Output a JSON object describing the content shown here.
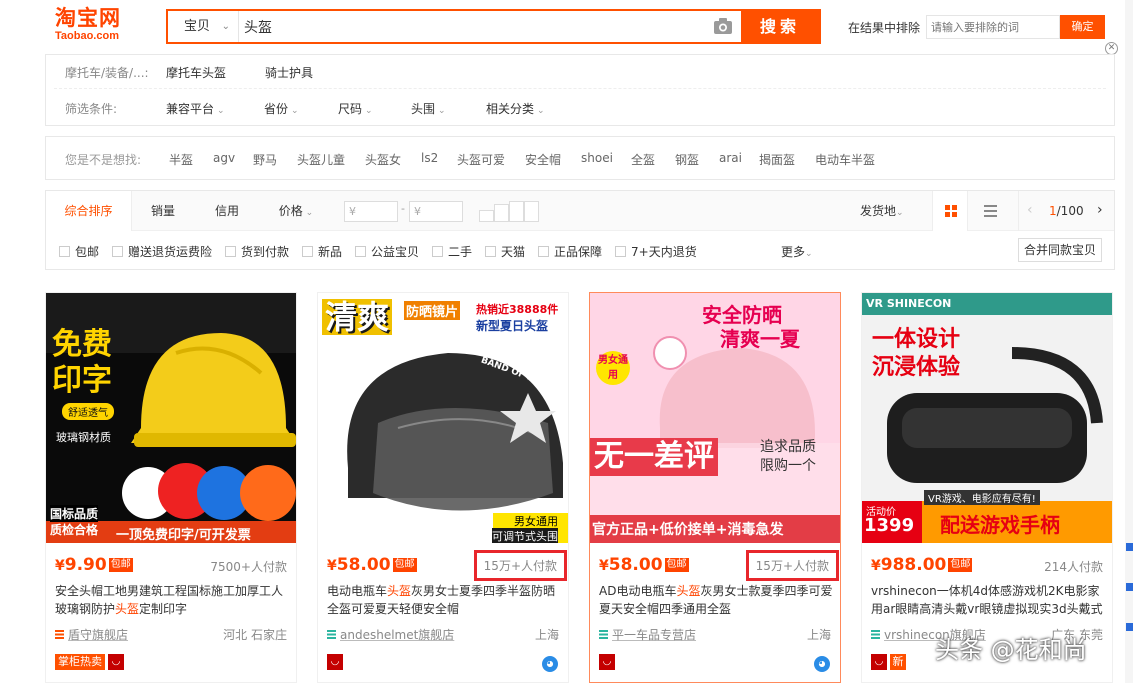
{
  "logo": {
    "cn": "淘宝网",
    "en": "Taobao.com"
  },
  "search": {
    "category": "宝贝",
    "query": "头盔",
    "button": "搜索"
  },
  "exclude": {
    "label": "在结果中排除",
    "placeholder": "请输入要排除的词",
    "confirm": "确定"
  },
  "filters": {
    "row1_key": "摩托车/装备/...:",
    "row1_values": [
      "摩托车头盔",
      "骑士护具"
    ],
    "row2_key": "筛选条件:",
    "row2_values": [
      "兼容平台",
      "省份",
      "尺码",
      "头围",
      "相关分类"
    ]
  },
  "suggest": {
    "label": "您是不是想找:",
    "items": [
      "半盔",
      "agv",
      "野马",
      "头盔儿童",
      "头盔女",
      "ls2",
      "头盔可爱",
      "安全帽",
      "shoei",
      "全盔",
      "钢盔",
      "arai",
      "揭面盔",
      "电动车半盔"
    ]
  },
  "sort": {
    "tabs": [
      "综合排序",
      "销量",
      "信用",
      "价格"
    ],
    "price_min_placeholder": "¥",
    "price_max_placeholder": "¥",
    "dash": "-",
    "ship_from": "发货地",
    "page_current": "1",
    "page_total": "/100"
  },
  "checks": {
    "items": [
      "包邮",
      "赠送退货运费险",
      "货到付款",
      "新品",
      "公益宝贝",
      "二手",
      "天猫",
      "正品保障",
      "7+天内退货"
    ],
    "more": "更多",
    "merge": "合并同款宝贝"
  },
  "products": [
    {
      "price": "9.90",
      "currency": "¥",
      "postage": "包邮",
      "paid": "7500+人付款",
      "title_pre": "安全头帽工地男建筑工程国标施工加厚工人玻璃钢防护",
      "title_kw": "头盔",
      "title_post": "定制印字",
      "shop": "盾守旗舰店",
      "loc": "河北 石家庄",
      "badge": "掌柜热卖",
      "img": {
        "line1": "免费",
        "line2": "印字",
        "sub": "舒适透气",
        "material": "玻璃钢材质",
        "b1": "国标品质",
        "b2": "质检合格",
        "banner": "一顶免费印字/可开发票"
      }
    },
    {
      "price": "58.00",
      "currency": "¥",
      "postage": "包邮",
      "paid": "15万+人付款",
      "title_pre": "电动电瓶车",
      "title_kw": "头盔",
      "title_post": "灰男女士夏季四季半盔防晒全盔可爱夏天轻便安全帽",
      "shop": "andeshelmet旗舰店",
      "loc": "上海",
      "img": {
        "big": "清爽",
        "tag1": "防晒镜片",
        "tag2": "热销近38888件",
        "tag3": "新型夏日头盔",
        "brand": "BAND OF BROTHERS",
        "c1": "男女通用",
        "c2": "可调节式头围"
      }
    },
    {
      "price": "58.00",
      "currency": "¥",
      "postage": "包邮",
      "paid": "15万+人付款",
      "title_pre": "AD电动电瓶车",
      "title_kw": "头盔",
      "title_post": "灰男女士款夏季四季可爱夏天安全帽四季通用全盔",
      "shop": "平一车品专营店",
      "loc": "上海",
      "img": {
        "top1": "安全防晒",
        "top2": "清爽一夏",
        "round": "男女通用",
        "mid": "无一差评",
        "r1": "追求品质",
        "r2": "限购一个",
        "bottom": "官方正品+低价接单+消毒急发"
      }
    },
    {
      "price": "988.00",
      "currency": "¥",
      "postage": "包邮",
      "paid": "214人付款",
      "title_pre": "vrshinecon一体机4d体感游戏机2K电影家用ar眼睛高清头戴vr眼镜虚拟现实3d头戴式",
      "title_kw": "",
      "title_post": "",
      "shop": "vrshinecon旗舰店",
      "loc": "广东 东莞",
      "img": {
        "brand": "VR SHINECON",
        "h1": "一体设计",
        "h2": "沉浸体验",
        "promo": "活动价",
        "price": "1399",
        "slogan": "配送游戏手柄",
        "note": "VR游戏、电影应有尽有!"
      }
    }
  ],
  "watermark": "头条 @花和尚",
  "colors": {
    "accent": "#ff5000",
    "price": "#ff4400",
    "highlight_box": "#e8262b"
  }
}
